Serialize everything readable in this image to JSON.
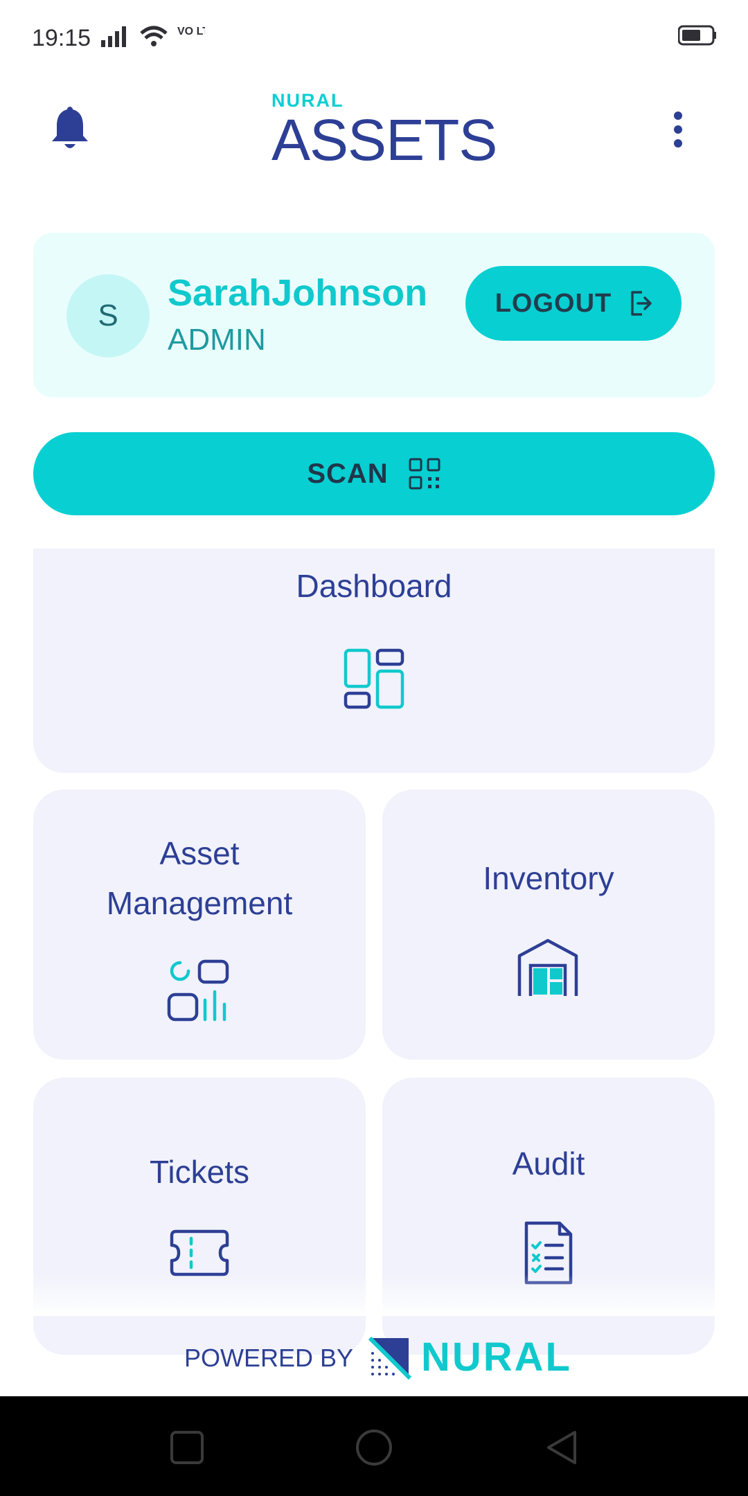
{
  "status_bar": {
    "time": "19:15",
    "network": "VO LTE"
  },
  "header": {
    "brand_small": "NURAL",
    "title": "ASSETS"
  },
  "user": {
    "initial": "S",
    "name": "SarahJohnson",
    "role": "ADMIN",
    "logout_label": "LOGOUT"
  },
  "scan": {
    "label": "SCAN"
  },
  "tiles": [
    {
      "label": "Dashboard",
      "icon": "dashboard-icon"
    },
    {
      "label": "Asset Management",
      "icon": "asset-management-icon"
    },
    {
      "label": "Inventory",
      "icon": "warehouse-icon"
    },
    {
      "label": "Tickets",
      "icon": "ticket-icon"
    },
    {
      "label": "Audit",
      "icon": "checklist-icon"
    }
  ],
  "footer": {
    "powered_by": "POWERED BY",
    "brand": "NURAL"
  },
  "colors": {
    "accent": "#08cfd2",
    "primary": "#2d3f95",
    "tile_bg": "#f1f2fb",
    "card_bg": "#eafdfd"
  }
}
